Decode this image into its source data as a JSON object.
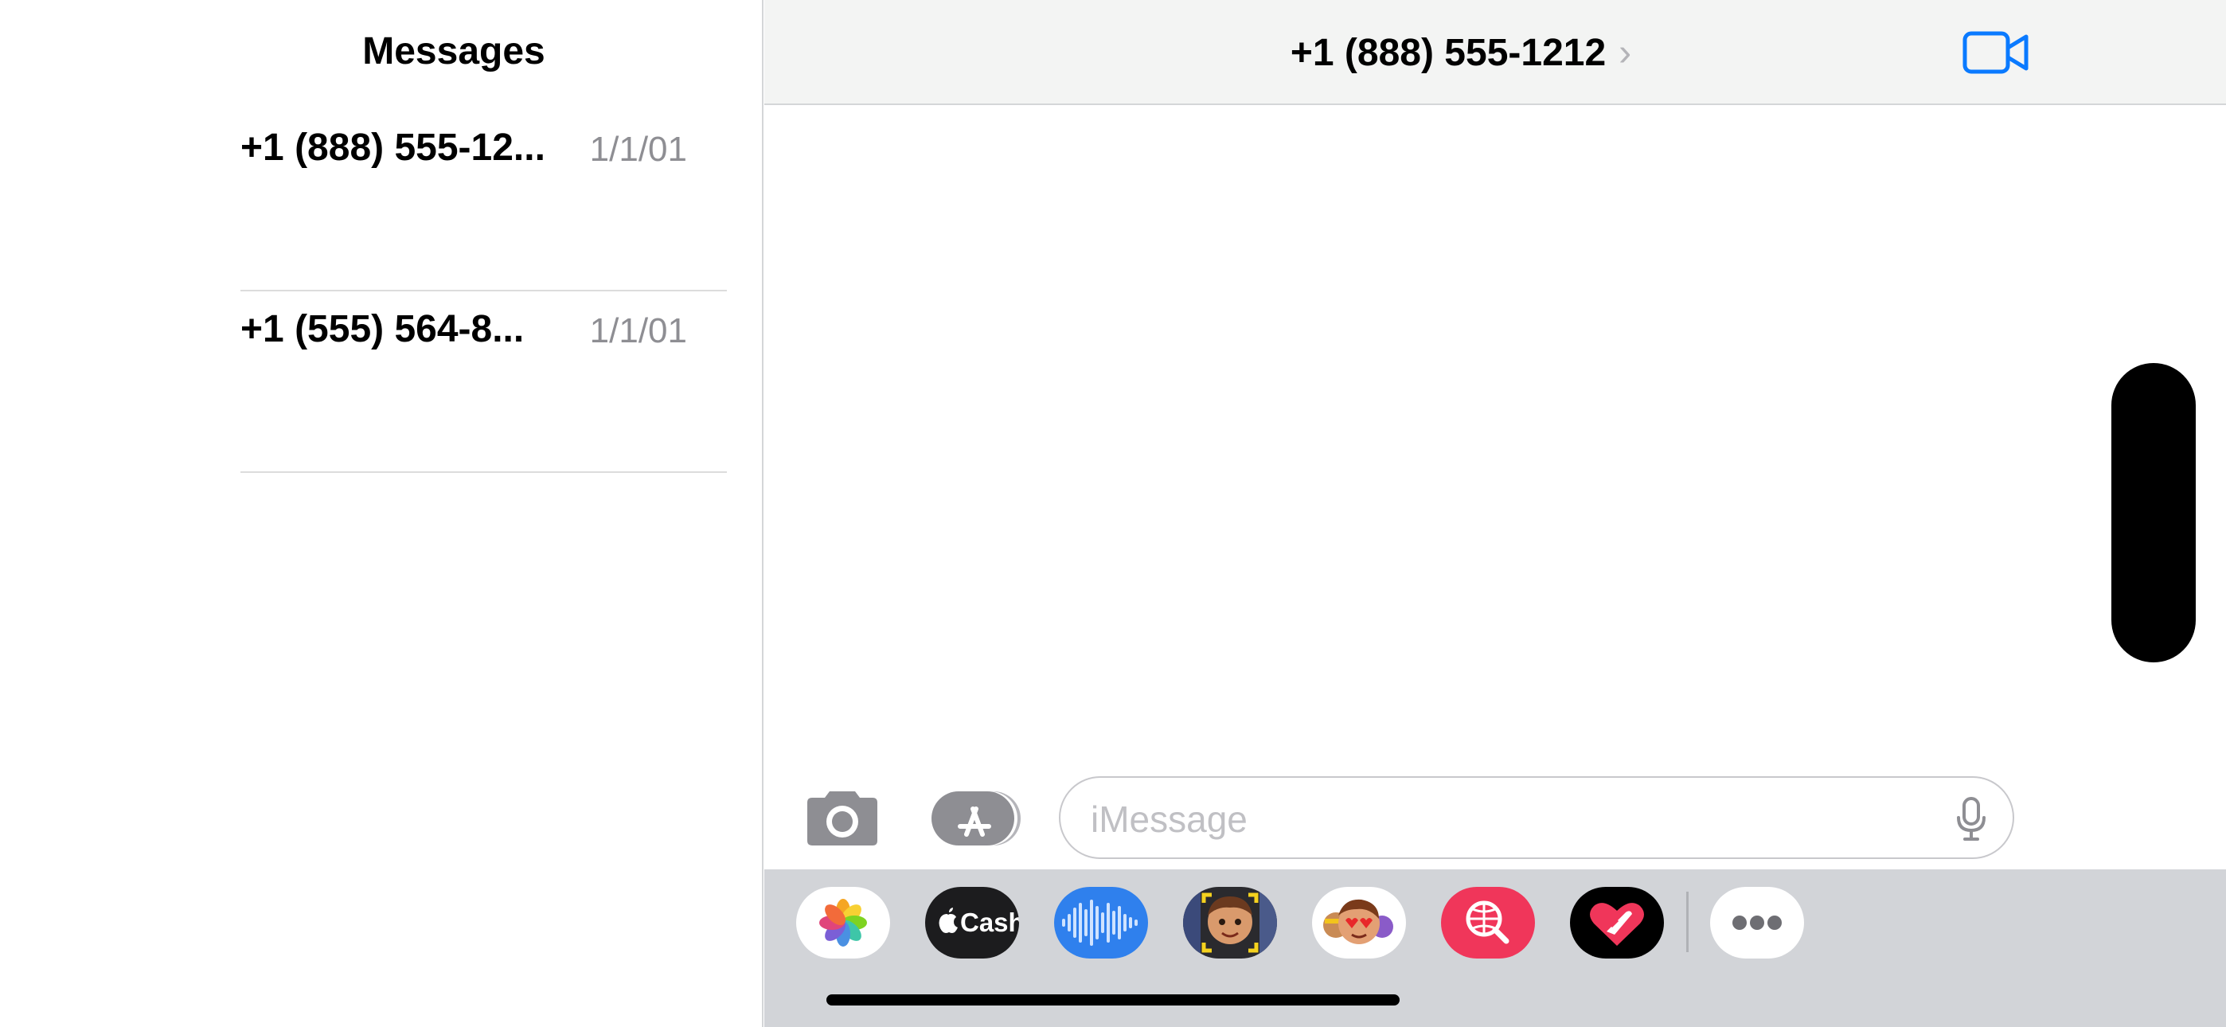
{
  "sidebar": {
    "title": "Messages",
    "conversations": [
      {
        "name": "+1 (888) 555-12...",
        "date": "1/1/01"
      },
      {
        "name": "+1 (555) 564-8...",
        "date": "1/1/01"
      }
    ]
  },
  "conversation": {
    "contact": "+1 (888) 555-1212",
    "chevron": "›"
  },
  "composer": {
    "placeholder": "iMessage"
  },
  "app_drawer": {
    "apps": [
      {
        "name": "photos-icon"
      },
      {
        "name": "apple-cash-icon",
        "label": "Cash"
      },
      {
        "name": "audio-message-icon"
      },
      {
        "name": "memoji-stickers-icon"
      },
      {
        "name": "animoji-icon"
      },
      {
        "name": "image-search-icon"
      },
      {
        "name": "digital-touch-icon"
      },
      {
        "name": "more-apps-icon"
      }
    ]
  },
  "colors": {
    "accent": "#0a7aff",
    "header_bg": "#f3f4f3",
    "drawer_bg": "#d2d4d8",
    "secondary_text": "#8e8e93"
  }
}
